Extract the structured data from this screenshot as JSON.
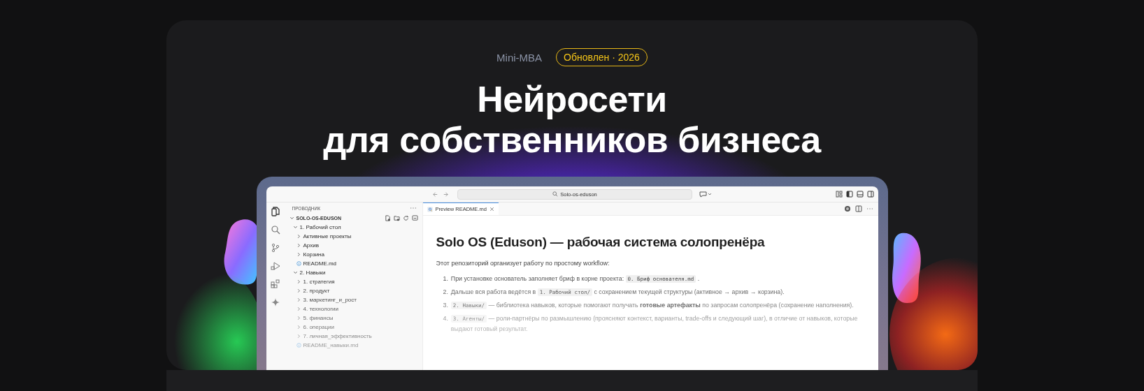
{
  "header": {
    "brand": "Mini-MBA",
    "badge": "Обновлен · 2026",
    "title_lines": [
      "Нейросети",
      "для собственников бизнеса"
    ]
  },
  "editor": {
    "search": {
      "value": "Solo-os-eduson"
    },
    "explorer": {
      "title": "ПРОВОДНИК",
      "tree": [
        {
          "label": "SOLO-OS-EDUSON",
          "kind": "folder",
          "expanded": true,
          "children": [
            {
              "label": "1. Рабочий стол",
              "kind": "folder",
              "expanded": true,
              "children": [
                {
                  "label": "Активные проекты",
                  "kind": "folder",
                  "expanded": false
                },
                {
                  "label": "Архив",
                  "kind": "folder",
                  "expanded": false
                },
                {
                  "label": "Корзина",
                  "kind": "folder",
                  "expanded": false
                },
                {
                  "label": "README.md",
                  "kind": "file"
                }
              ]
            },
            {
              "label": "2. Навыки",
              "kind": "folder",
              "expanded": true,
              "children": [
                {
                  "label": "1. стратегия",
                  "kind": "folder",
                  "expanded": false
                },
                {
                  "label": "2. продукт",
                  "kind": "folder",
                  "expanded": false
                },
                {
                  "label": "3. маркетинг_и_рост",
                  "kind": "folder",
                  "expanded": false
                },
                {
                  "label": "4. технологии",
                  "kind": "folder",
                  "expanded": false
                },
                {
                  "label": "5. финансы",
                  "kind": "folder",
                  "expanded": false
                },
                {
                  "label": "6. операции",
                  "kind": "folder",
                  "expanded": false
                },
                {
                  "label": "7. личная_эффективность",
                  "kind": "folder",
                  "expanded": false
                },
                {
                  "label": "README_навыки.md",
                  "kind": "file"
                }
              ]
            }
          ]
        }
      ]
    },
    "tabs": [
      {
        "label": "Preview README.md",
        "selected": true
      }
    ],
    "document": {
      "heading": "Solo OS (Eduson) — рабочая система солопренёра",
      "intro": "Этот репозиторий организует работу по простому workflow:",
      "items": [
        {
          "number": "1.",
          "parts": [
            {
              "kind": "text",
              "text": "При установке основатель заполняет бриф в корне проекта: "
            },
            {
              "kind": "code",
              "text": "0. Бриф основателя.md"
            },
            {
              "kind": "text",
              "text": " ."
            }
          ]
        },
        {
          "number": "2.",
          "parts": [
            {
              "kind": "text",
              "text": "Дальше вся работа ведётся в "
            },
            {
              "kind": "code",
              "text": "1. Рабочий стол/"
            },
            {
              "kind": "text",
              "text": " с сохранением текущей структуры (активное → архив → корзина)."
            }
          ]
        },
        {
          "number": "3.",
          "parts": [
            {
              "kind": "code",
              "text": "2. Навыки/"
            },
            {
              "kind": "text",
              "text": " — библиотека навыков, которые помогают получать "
            },
            {
              "kind": "bold",
              "text": "готовые артефакты"
            },
            {
              "kind": "text",
              "text": " по запросам солопренёра (сохранение наполнения)."
            }
          ]
        },
        {
          "number": "4.",
          "parts": [
            {
              "kind": "code",
              "text": "3. Агенты/"
            },
            {
              "kind": "text",
              "text": " — роли-партнёры по размышлению (проясняют контекст, варианты, trade-offs и следующий шаг), в отличие от навыков, которые выдают готовый результат."
            }
          ]
        }
      ]
    }
  }
}
